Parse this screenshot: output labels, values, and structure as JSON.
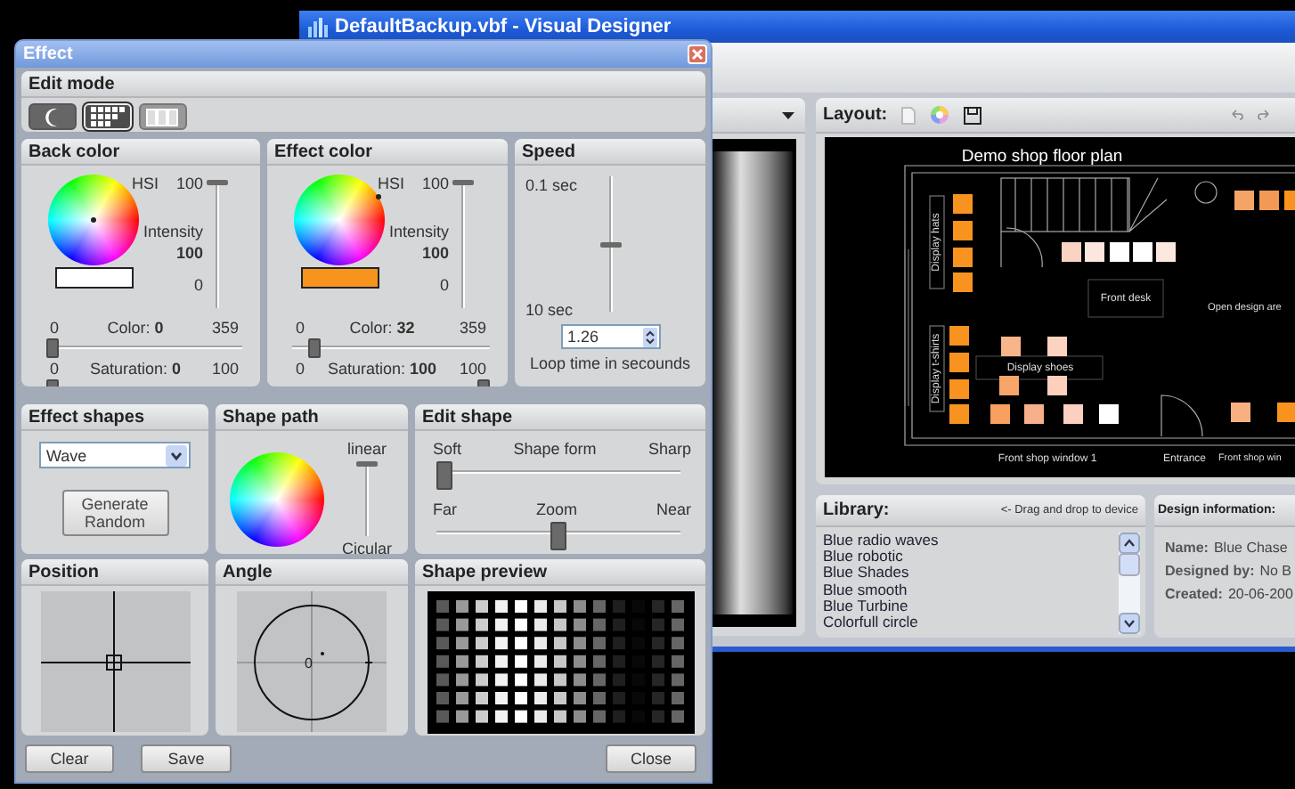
{
  "main_window": {
    "title": "DefaultBackup.vbf - Visual Designer",
    "layout": {
      "label": "Layout:",
      "floor_plan": {
        "title": "Demo shop floor plan",
        "display_hats": "Display hats",
        "front_desk": "Front desk",
        "open_design_area": "Open design are",
        "display_tshirts": "Display t-shirts",
        "display_shoes": "Display shoes",
        "front_window_1": "Front shop window 1",
        "entrance": "Entrance",
        "front_window_2": "Front shop win"
      }
    },
    "library": {
      "title": "Library:",
      "hint": "<- Drag and drop to device",
      "items": [
        "Blue radio waves",
        "Blue robotic",
        "Blue Shades",
        "Blue smooth",
        "Blue Turbine",
        "Colorfull circle"
      ]
    },
    "design_information": {
      "title": "Design information:",
      "fields": [
        {
          "label": "Name:",
          "value": "Blue Chase"
        },
        {
          "label": "Designed by:",
          "value": "No B"
        },
        {
          "label": "Created:",
          "value": "20-06-200"
        }
      ]
    }
  },
  "effect_dialog": {
    "title": "Effect",
    "edit_mode": {
      "title": "Edit mode",
      "modes": [
        {
          "kind": "crescent",
          "selected": false,
          "disabled": false
        },
        {
          "kind": "grid",
          "selected": true,
          "disabled": false
        },
        {
          "kind": "bars",
          "selected": false,
          "disabled": true
        }
      ]
    },
    "back_color": {
      "title": "Back color",
      "hsi_label": "HSI",
      "intensity": {
        "max": "100",
        "label": "Intensity",
        "value": "100",
        "min": "0",
        "level": 1
      },
      "swatch": {
        "color": "#ffffff"
      },
      "color": {
        "min": "0",
        "reading": "Color: **0**",
        "max": "359",
        "level": 0
      },
      "saturation": {
        "min": "0",
        "reading": "Saturation: **0**",
        "max": "100",
        "level": 0
      }
    },
    "effect_color": {
      "title": "Effect color",
      "hsi_label": "HSI",
      "intensity": {
        "max": "100",
        "label": "Intensity",
        "value": "100",
        "min": "0",
        "level": 1
      },
      "swatch": {
        "color": "#f7941d"
      },
      "color": {
        "min": "0",
        "reading": "Color: **32**",
        "max": "359",
        "level": 0.089
      },
      "saturation": {
        "min": "0",
        "reading": "Saturation: **100**",
        "max": "100",
        "level": 1
      }
    },
    "speed": {
      "title": "Speed",
      "top_label": "0.1 sec",
      "bottom_label": "10 sec",
      "level": 0.5,
      "value": "1.26",
      "caption": "Loop time in secounds"
    },
    "effect_shapes": {
      "title": "Effect shapes",
      "dropdown": {
        "value": "Wave"
      },
      "button": "Generate Random"
    },
    "shape_path": {
      "title": "Shape path",
      "top_label": "linear",
      "bottom_label": "Cicular",
      "level": 1
    },
    "edit_shape": {
      "title": "Edit shape",
      "sliders": [
        {
          "left": "Soft",
          "label": "Shape form",
          "right": "Sharp",
          "level": 0
        },
        {
          "left": "Far",
          "label": "Zoom",
          "right": "Near",
          "level": 0.5
        }
      ]
    },
    "position": {
      "title": "Position"
    },
    "angle": {
      "title": "Angle",
      "value": "0"
    },
    "shape_preview": {
      "title": "Shape preview"
    },
    "buttons": [
      {
        "label": "Clear"
      },
      {
        "label": "Save"
      },
      {
        "label": "Close"
      }
    ]
  }
}
